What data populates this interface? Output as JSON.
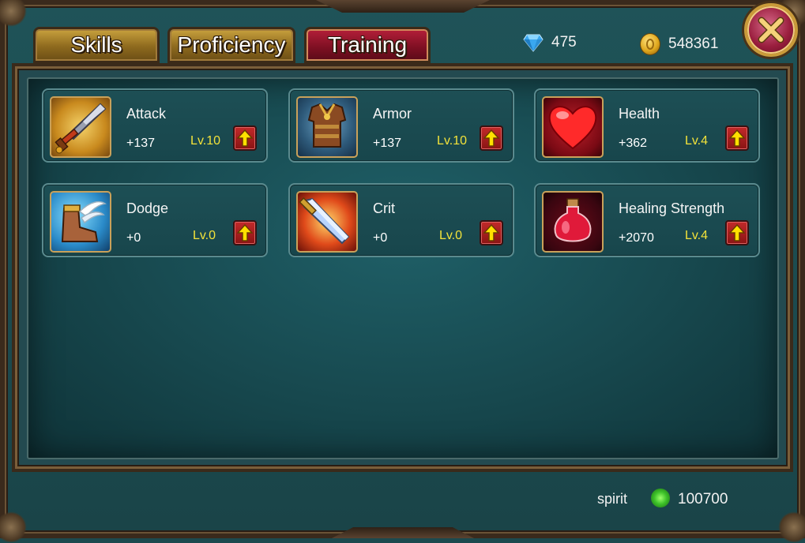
{
  "tabs": [
    {
      "label": "Skills",
      "active": false
    },
    {
      "label": "Proficiency",
      "active": false
    },
    {
      "label": "Training",
      "active": true
    }
  ],
  "currency": {
    "gems": "475",
    "gold": "548361"
  },
  "stats": [
    {
      "name": "Attack",
      "bonus": "+137",
      "level": "Lv.10",
      "icon": "sword-icon"
    },
    {
      "name": "Armor",
      "bonus": "+137",
      "level": "Lv.10",
      "icon": "armor-icon"
    },
    {
      "name": "Health",
      "bonus": "+362",
      "level": "Lv.4",
      "icon": "heart-icon"
    },
    {
      "name": "Dodge",
      "bonus": "+0",
      "level": "Lv.0",
      "icon": "winged-boot-icon"
    },
    {
      "name": "Crit",
      "bonus": "+0",
      "level": "Lv.0",
      "icon": "crit-blade-icon"
    },
    {
      "name": "Healing Strength",
      "bonus": "+2070",
      "level": "Lv.4",
      "icon": "potion-icon"
    }
  ],
  "footer": {
    "spirit_label": "spirit",
    "spirit_value": "100700"
  },
  "colors": {
    "panel_bg": "#17484e",
    "level_text": "#f2e23a",
    "active_tab": "#7c0f22",
    "inactive_tab": "#8e6a1e"
  }
}
